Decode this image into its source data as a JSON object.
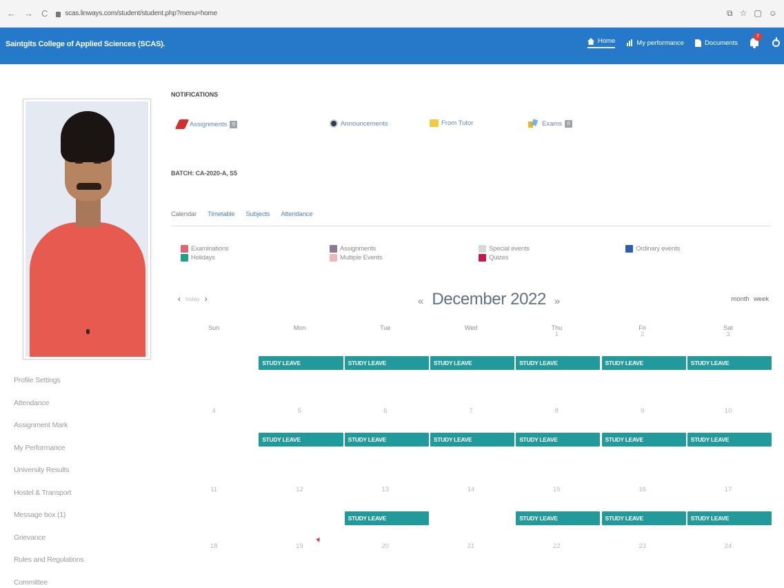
{
  "browser": {
    "url": "scas.linways.com/student/student.php?menu=home",
    "back_icon": "←",
    "forward_icon": "→",
    "reload_icon": "C"
  },
  "header": {
    "title": "Saintgits College of Applied Sciences (SCAS).",
    "nav": [
      {
        "icon": "home-icon",
        "label": "Home"
      },
      {
        "icon": "bar-chart-icon",
        "label": "My performance"
      },
      {
        "icon": "document-icon",
        "label": "Documents"
      }
    ],
    "notification_count": "2"
  },
  "sidebar": {
    "items": [
      "Profile Settings",
      "Attendance",
      "Assignment Mark",
      "My Performance",
      "University Results",
      "Hostel & Transport",
      "Message box (1)",
      "Grievance",
      "Rules and Regulations",
      "Committee"
    ]
  },
  "notifications": {
    "title": "NOTIFICATIONS",
    "items": [
      {
        "label": "Assignments",
        "badge": "0"
      },
      {
        "label": "Announcements",
        "badge": ""
      },
      {
        "label": "From Tutor",
        "badge": ""
      },
      {
        "label": "Exams",
        "badge": "0"
      }
    ]
  },
  "batch": "BATCH: CA-2020-A, S5",
  "tabs": [
    "Calendar",
    "Timetable",
    "Subjects",
    "Attendance"
  ],
  "legend": [
    {
      "label": "Examinations",
      "color": "#e36079"
    },
    {
      "label": "Holidays",
      "color": "#1ea08a"
    },
    {
      "label": "Assignments",
      "color": "#8a7a96"
    },
    {
      "label": "Multiple Events",
      "color": "#eeb6b6"
    },
    {
      "label": "Special events",
      "color": "#d7d7d7"
    },
    {
      "label": "Quizes",
      "color": "#c21a4c"
    },
    {
      "label": "Ordinary events",
      "color": "#2a5fab"
    }
  ],
  "calendar": {
    "title": "December 2022",
    "prev_icon": "«",
    "next_icon": "»",
    "today_label": "today",
    "views": [
      "month",
      "week"
    ],
    "days_of_week": [
      "Sun",
      "Mon",
      "Tue",
      "Wed",
      "Thu",
      "Fri",
      "Sat"
    ],
    "weeks": [
      {
        "days": [
          "",
          "",
          "",
          "",
          "1",
          "2",
          "3"
        ],
        "events": [
          1,
          2,
          3,
          4,
          5,
          6
        ]
      },
      {
        "days": [
          "4",
          "5",
          "6",
          "7",
          "8",
          "9",
          "10"
        ],
        "events": [
          1,
          2,
          3,
          4,
          5,
          6
        ]
      },
      {
        "days": [
          "11",
          "12",
          "13",
          "14",
          "15",
          "16",
          "17"
        ],
        "events": [
          2,
          4,
          5,
          6
        ]
      },
      {
        "days": [
          "18",
          "19",
          "20",
          "21",
          "22",
          "23",
          "24"
        ],
        "events": []
      }
    ],
    "event_label": "STUDY LEAVE",
    "event_color": "#22999a"
  }
}
